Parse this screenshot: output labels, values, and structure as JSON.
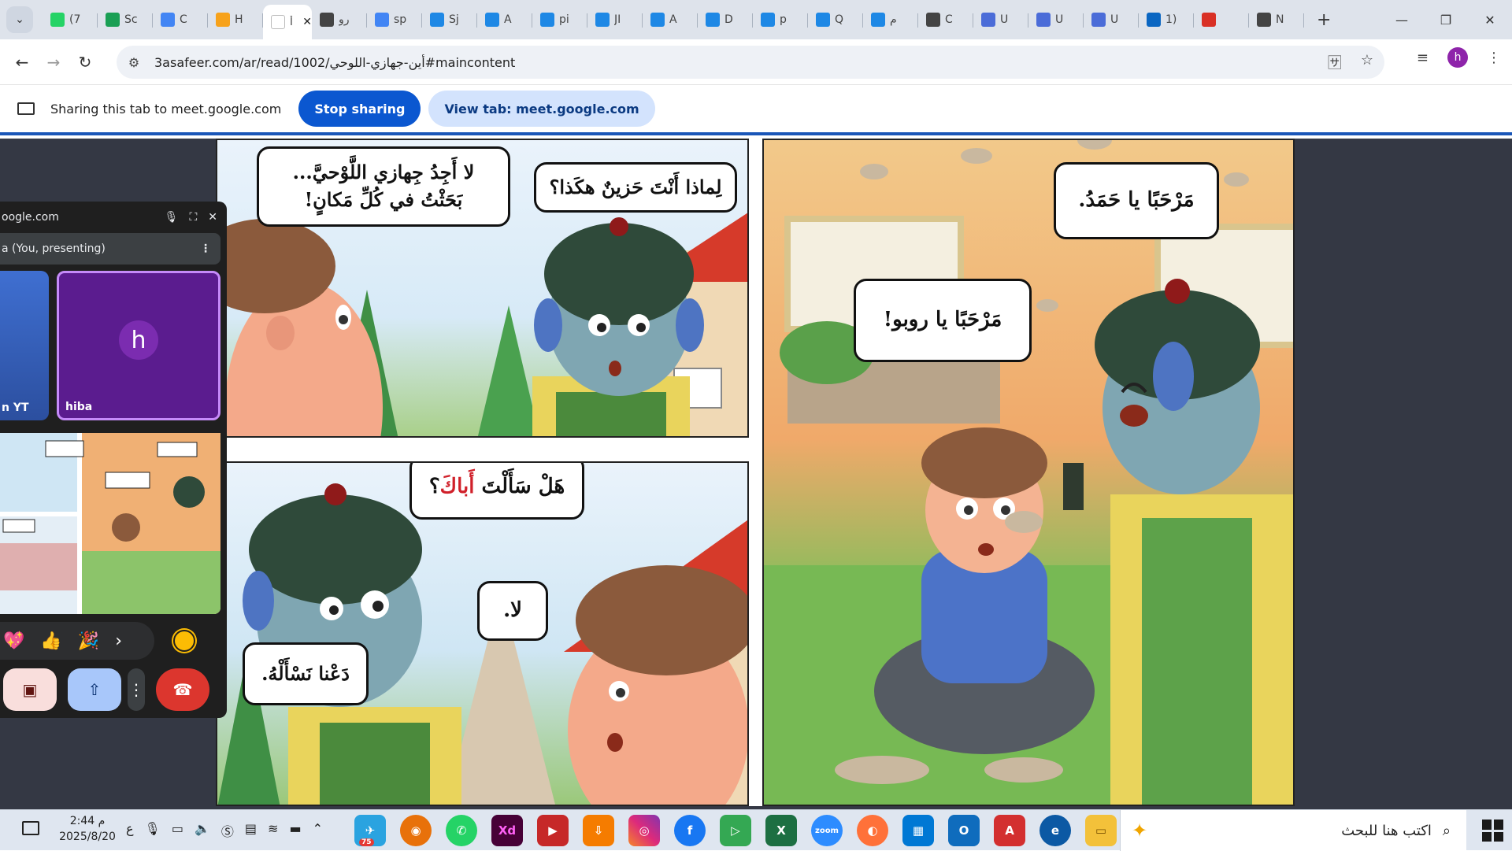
{
  "browser": {
    "tabs": [
      {
        "title": "(7",
        "color": "#25d366",
        "icon": "whatsapp-icon"
      },
      {
        "title": "Sc",
        "color": "#1a9f54",
        "icon": "plus-icon"
      },
      {
        "title": "C",
        "color": "#4285f4",
        "icon": "chrome-icon"
      },
      {
        "title": "H",
        "color": "#f7a21b",
        "icon": "five-icon"
      },
      {
        "title": "أَ",
        "color": "#ffffff",
        "icon": "page-icon",
        "active": true
      },
      {
        "title": "رو",
        "color": "#444444",
        "icon": "openai-icon"
      },
      {
        "title": "sp",
        "color": "#4285f4",
        "icon": "google-icon"
      },
      {
        "title": "Sj",
        "color": "#1e88e5",
        "icon": "puzzle-icon"
      },
      {
        "title": "A",
        "color": "#1e88e5",
        "icon": "puzzle-icon"
      },
      {
        "title": "pi",
        "color": "#1e88e5",
        "icon": "puzzle-icon"
      },
      {
        "title": "JI",
        "color": "#1e88e5",
        "icon": "puzzle-icon"
      },
      {
        "title": "A",
        "color": "#1e88e5",
        "icon": "puzzle-icon"
      },
      {
        "title": "D",
        "color": "#1e88e5",
        "icon": "puzzle-icon"
      },
      {
        "title": "p",
        "color": "#1e88e5",
        "icon": "puzzle-icon"
      },
      {
        "title": "Q",
        "color": "#1e88e5",
        "icon": "puzzle-icon"
      },
      {
        "title": "م",
        "color": "#1e88e5",
        "icon": "puzzle-icon"
      },
      {
        "title": "C",
        "color": "#444444",
        "icon": "openai-icon"
      },
      {
        "title": "U",
        "color": "#4b6cd8",
        "icon": "docs-icon"
      },
      {
        "title": "U",
        "color": "#4b6cd8",
        "icon": "docs-icon"
      },
      {
        "title": "U",
        "color": "#4b6cd8",
        "icon": "docs-icon"
      },
      {
        "title": "1)",
        "color": "#0a66c2",
        "icon": "linkedin-icon"
      },
      {
        "title": "",
        "color": "#d93025",
        "icon": "record-icon"
      },
      {
        "title": "N",
        "color": "#444444",
        "icon": "openai-icon"
      }
    ],
    "new_tab": "+",
    "window_controls": {
      "minimize": "—",
      "restore": "❐",
      "close": "✕"
    },
    "url": "3asafeer.com/ar/read/1002/أين-جهازي-اللوحي#maincontent",
    "profile_initial": "h",
    "profile_color": "#8e24aa"
  },
  "sharebar": {
    "message": "Sharing this tab to meet.google.com",
    "stop_label": "Stop sharing",
    "view_label": "View tab: meet.google.com"
  },
  "comic": {
    "panel1_line1": "لا أَجِدُ جِهازي اللَّوْحيَّ...",
    "panel1_line2": "بَحَثْتُ في كُلِّ مَكانٍ!",
    "panel2": "لِماذا أَنْتَ حَزينٌ هكَذا؟",
    "panel3_before": "هَلْ سَأَلْتَ ",
    "panel3_highlight": "أَباكَ",
    "panel3_after": "؟",
    "panel3_no": "لا.",
    "panel3_letus": "دَعْنا نَسْأَلْهُ.",
    "panel4_top": "مَرْحَبًا يا حَمَدُ.",
    "panel4_mid": "مَرْحَبًا يا روبو!"
  },
  "meet": {
    "domain": "oogle.com",
    "presenting": "a (You, presenting)",
    "tile_yt_label": "n YT",
    "tile_hiba_label": "hiba",
    "avatar_initial": "h",
    "reactions": [
      "💖",
      "👍",
      "🎉"
    ],
    "more": "›"
  },
  "taskbar": {
    "time": "2:44 م",
    "date": "2025/8/20",
    "lang": "ع",
    "search_placeholder": "اكتب هنا للبحث",
    "telegram_badge": "75"
  }
}
